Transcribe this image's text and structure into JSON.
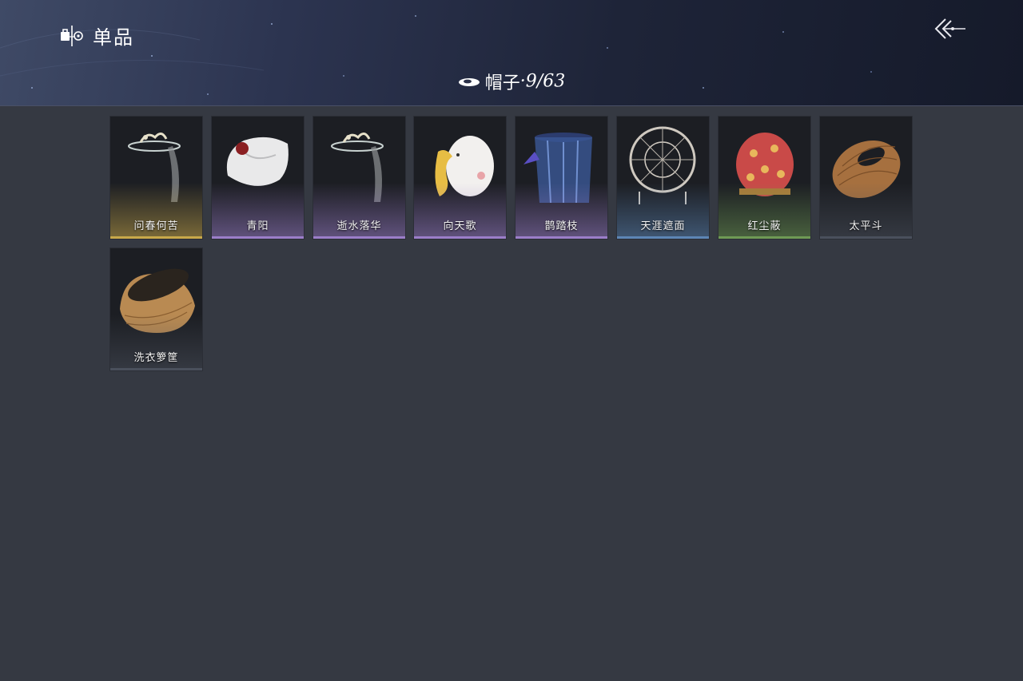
{
  "header": {
    "title": "单品",
    "title_icon": "wardrobe-icon",
    "back_icon": "back-arrow-icon"
  },
  "category": {
    "icon": "hat-icon",
    "name": "帽子",
    "count": "·9/63"
  },
  "items": [
    {
      "name": "问春何苦",
      "rarity_color": "#c9a94a",
      "icon": "veiled-hat-icon"
    },
    {
      "name": "青阳",
      "rarity_color": "#9b7ec9",
      "icon": "white-cap-icon"
    },
    {
      "name": "逝水落华",
      "rarity_color": "#9b7ec9",
      "icon": "veiled-hat-icon"
    },
    {
      "name": "向天歌",
      "rarity_color": "#9b7ec9",
      "icon": "goose-hood-icon"
    },
    {
      "name": "鹊踏枝",
      "rarity_color": "#9b7ec9",
      "icon": "blue-veil-icon"
    },
    {
      "name": "天涯遮面",
      "rarity_color": "#5d86b5",
      "icon": "round-bamboo-hat-icon"
    },
    {
      "name": "红尘蔽",
      "rarity_color": "#6f9a55",
      "icon": "red-hood-icon"
    },
    {
      "name": "太平斗",
      "rarity_color": "#4a505c",
      "icon": "wicker-hat-icon"
    },
    {
      "name": "洗衣箩筐",
      "rarity_color": "#4a505c",
      "icon": "laundry-basket-icon"
    }
  ]
}
